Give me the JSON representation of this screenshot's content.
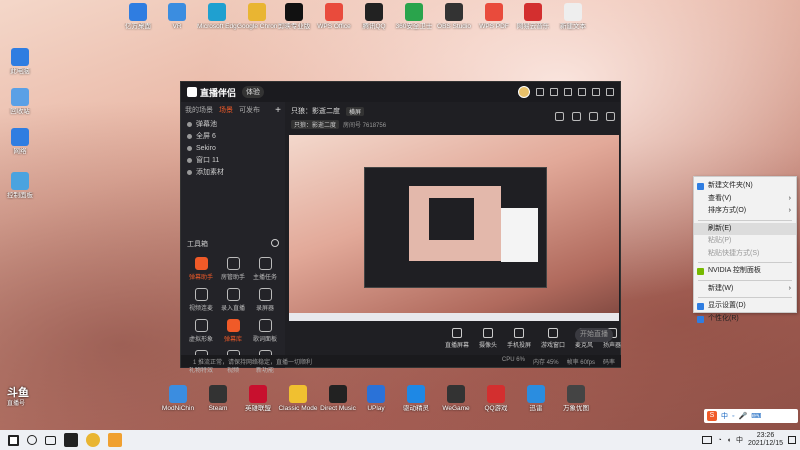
{
  "desktop": {
    "top_icons": [
      {
        "label": "亿方桌面",
        "color": "#2f7de1"
      },
      {
        "label": "VR",
        "color": "#3b8de0"
      },
      {
        "label": "Microsoft Edge",
        "color": "#1fa0d0"
      },
      {
        "label": "Google Chrome",
        "color": "#e9b532"
      },
      {
        "label": "剪映专业版",
        "color": "#111111"
      },
      {
        "label": "WPS Office",
        "color": "#e94b3c"
      },
      {
        "label": "腾讯QQ",
        "color": "#222222"
      },
      {
        "label": "360安全卫士",
        "color": "#2aa44c"
      },
      {
        "label": "OBS Studio",
        "color": "#333333"
      },
      {
        "label": "WPS PDF",
        "color": "#e94b3c"
      },
      {
        "label": "网易云音乐",
        "color": "#d32f2f"
      },
      {
        "label": "新建文本",
        "color": "#eeeeee"
      }
    ],
    "left_icons": [
      {
        "label": "此电脑",
        "color": "#2f7de1"
      },
      {
        "label": "回收站",
        "color": "#5aa0e6"
      },
      {
        "label": "网络",
        "color": "#2f7de1"
      },
      {
        "label": "控制面板",
        "color": "#4aa3df"
      }
    ],
    "bottom_icons": [
      {
        "label": "ModNiChin",
        "color": "#3b8de0"
      },
      {
        "label": "Steam",
        "color": "#333333"
      },
      {
        "label": "英雄联盟",
        "color": "#c8102e"
      },
      {
        "label": "Classic Mode",
        "color": "#f0c030"
      },
      {
        "label": "Direct Music",
        "color": "#222222"
      },
      {
        "label": "UPlay",
        "color": "#2a72d8"
      },
      {
        "label": "驱动精灵",
        "color": "#1e88e5"
      },
      {
        "label": "WeGame",
        "color": "#333333"
      },
      {
        "label": "QQ游戏",
        "color": "#d32f2f"
      },
      {
        "label": "迅雷",
        "color": "#2a8de0"
      },
      {
        "label": "万象优图",
        "color": "#444444"
      }
    ],
    "watermark": "斗鱼",
    "watermark_sub": "直播号"
  },
  "app": {
    "logo": "直播伴侣",
    "version": "体验",
    "tabs": [
      "我的场景",
      "场景",
      "可发布"
    ],
    "scenes": [
      "弹幕池",
      "全屏 6",
      "Sekiro",
      "窗口 11",
      "添加素材"
    ],
    "tools_title": "工具箱",
    "tools": [
      {
        "label": "弹幕助手",
        "hot": true
      },
      {
        "label": "房管助手",
        "hot": false
      },
      {
        "label": "主播任务",
        "hot": false
      },
      {
        "label": "视频连麦",
        "hot": false
      },
      {
        "label": "录入直播",
        "hot": false
      },
      {
        "label": "录屏器",
        "hot": false
      },
      {
        "label": "虚拟形象",
        "hot": false
      },
      {
        "label": "弹幕库",
        "hot": true
      },
      {
        "label": "歌词面板",
        "hot": false
      },
      {
        "label": "礼物特效",
        "hot": false
      },
      {
        "label": "视频",
        "hot": false
      },
      {
        "label": "新功能",
        "hot": false
      }
    ],
    "stream_title": "只狼：影逝二度",
    "stream_mode": "横屏",
    "meta_chip": "只狼：影逝二度",
    "meta_text": "房间号 7618756",
    "controls": [
      "直播屏幕",
      "摄像头",
      "手机投屏",
      "游戏窗口",
      "麦克风",
      "扬声器"
    ],
    "live_button": "开始直播",
    "status_left": "1 推流正常，请保持网络稳定，直播一切顺利",
    "status_right": [
      "CPU 6%",
      "内存 45%",
      "帧率 60fps",
      "码率"
    ]
  },
  "context_menu": {
    "items": [
      {
        "label": "新建文件夹(N)",
        "disabled": false,
        "arrow": false,
        "icon": "#2f7de1"
      },
      {
        "label": "查看(V)",
        "disabled": false,
        "arrow": true,
        "icon": ""
      },
      {
        "label": "排序方式(O)",
        "disabled": false,
        "arrow": true,
        "icon": ""
      },
      {
        "label": "刷新(E)",
        "disabled": false,
        "arrow": false,
        "icon": "",
        "selected": true
      },
      {
        "label": "粘贴(P)",
        "disabled": true,
        "arrow": false,
        "icon": ""
      },
      {
        "label": "粘贴快捷方式(S)",
        "disabled": true,
        "arrow": false,
        "icon": ""
      },
      {
        "label": "NVIDIA 控制面板",
        "disabled": false,
        "arrow": false,
        "icon": "#76b900"
      },
      {
        "label": "新建(W)",
        "disabled": false,
        "arrow": true,
        "icon": ""
      },
      {
        "label": "显示设置(D)",
        "disabled": false,
        "arrow": false,
        "icon": "#2f7de1"
      },
      {
        "label": "个性化(R)",
        "disabled": false,
        "arrow": false,
        "icon": "#2f7de1"
      }
    ]
  },
  "taskbar": {
    "time": "23:26",
    "date": "2021/12/15",
    "ime": "中"
  }
}
